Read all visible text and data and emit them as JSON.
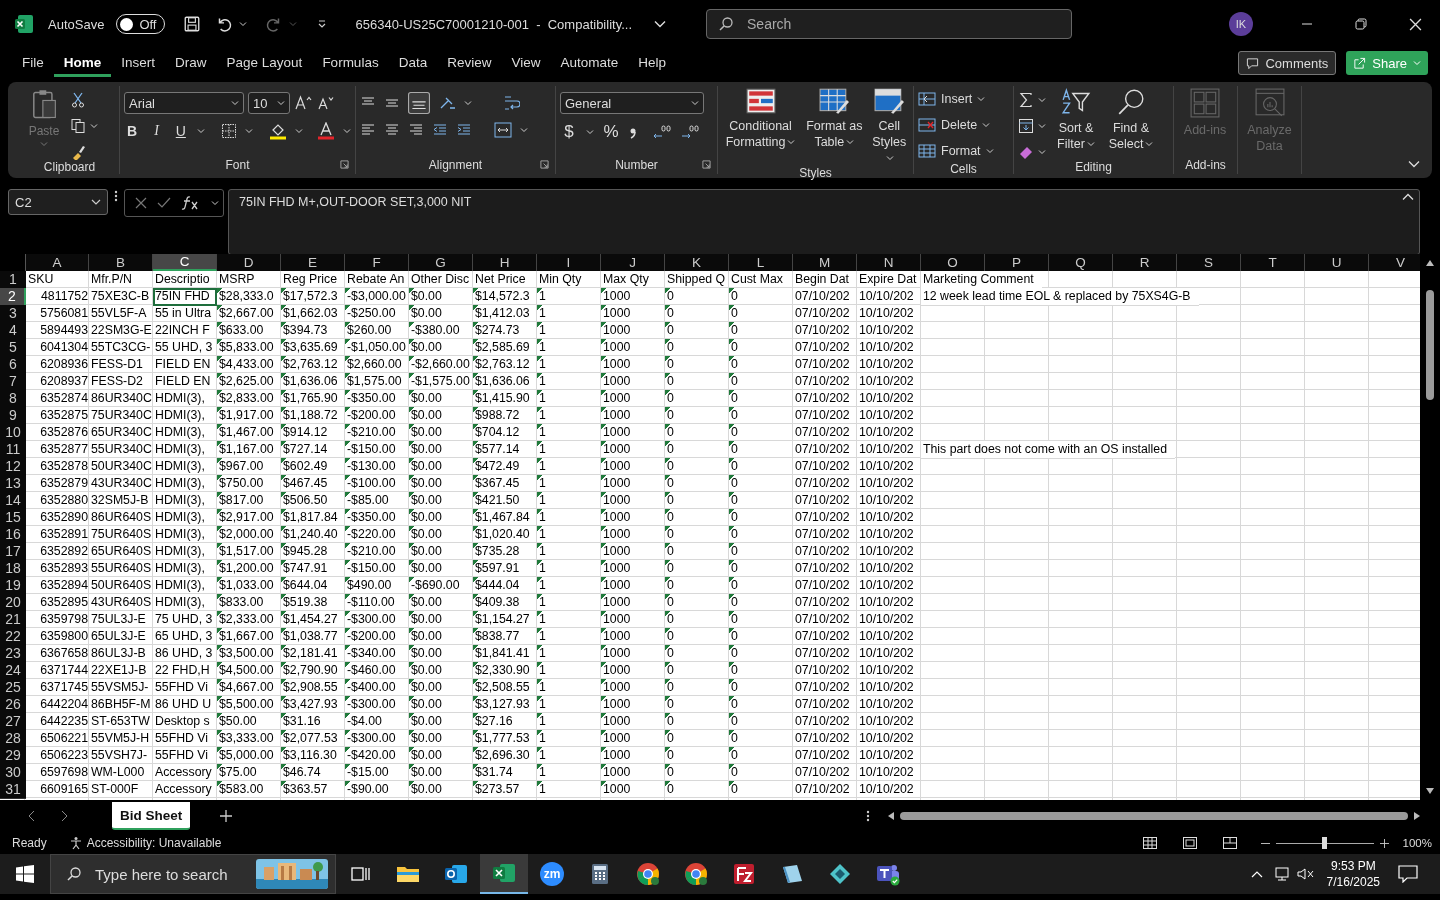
{
  "title_bar": {
    "autosave_label": "AutoSave",
    "autosave": {
      "on": false,
      "label": "Off"
    },
    "document_title": "656340-US25C70001210-001  -  Compatibility...",
    "search": {
      "placeholder": "Search"
    },
    "avatar": "IK"
  },
  "menu_tabs": [
    {
      "label": "File",
      "selected": false
    },
    {
      "label": "Home",
      "selected": true
    },
    {
      "label": "Insert",
      "selected": false
    },
    {
      "label": "Draw",
      "selected": false
    },
    {
      "label": "Page Layout",
      "selected": false
    },
    {
      "label": "Formulas",
      "selected": false
    },
    {
      "label": "Data",
      "selected": false
    },
    {
      "label": "Review",
      "selected": false
    },
    {
      "label": "View",
      "selected": false
    },
    {
      "label": "Automate",
      "selected": false
    },
    {
      "label": "Help",
      "selected": false
    }
  ],
  "header_buttons": [
    {
      "kind": "comments",
      "label": "Comments"
    },
    {
      "kind": "share",
      "label": "Share"
    }
  ],
  "ribbon": {
    "clipboard": {
      "label": "Clipboard",
      "paste": {
        "label": "Paste",
        "disabled": true
      }
    },
    "font": {
      "label": "Font",
      "family": "Arial",
      "size": "10",
      "bold": "B",
      "italic": "I",
      "underline": "U"
    },
    "alignment": {
      "label": "Alignment"
    },
    "number": {
      "label": "Number",
      "format": "General",
      "currency": "$",
      "percent": "%"
    },
    "styles": {
      "label": "Styles",
      "buttons": [
        {
          "kind": "conditional",
          "label": "Conditional Formatting"
        },
        {
          "kind": "table",
          "label": "Format as Table"
        },
        {
          "kind": "cellstyles",
          "label": "Cell Styles"
        }
      ]
    },
    "cells": {
      "label": "Cells",
      "buttons": [
        {
          "kind": "insert",
          "label": "Insert"
        },
        {
          "kind": "delete",
          "label": "Delete"
        },
        {
          "kind": "format",
          "label": "Format"
        }
      ]
    },
    "editing": {
      "label": "Editing",
      "buttons": [
        {
          "kind": "sort",
          "label": "Sort & Filter"
        },
        {
          "kind": "find",
          "label": "Find & Select"
        }
      ]
    },
    "addins": {
      "label": "Add-ins",
      "button": {
        "label": "Add-ins",
        "disabled": true
      }
    },
    "analyze": {
      "label": "Analyze Data",
      "disabled": true
    }
  },
  "formula_bar": {
    "name_box": "C2",
    "formula": "75IN FHD M+,OUT-DOOR SET,3,000 NIT"
  },
  "sheet": {
    "columns": [
      {
        "letter": "A",
        "kind": "numeric",
        "selected": false
      },
      {
        "letter": "B",
        "selected": false
      },
      {
        "letter": "C",
        "selected": true
      },
      {
        "letter": "D",
        "flagged": true,
        "selected": false
      },
      {
        "letter": "E",
        "flagged": true,
        "selected": false
      },
      {
        "letter": "F",
        "flagged": true,
        "selected": false
      },
      {
        "letter": "G",
        "flagged": true,
        "selected": false
      },
      {
        "letter": "H",
        "flagged": true,
        "selected": false
      },
      {
        "letter": "I",
        "flagged": true,
        "selected": false
      },
      {
        "letter": "J",
        "flagged": true,
        "selected": false
      },
      {
        "letter": "K",
        "flagged": true,
        "selected": false
      },
      {
        "letter": "L",
        "flagged": true,
        "selected": false
      },
      {
        "letter": "M",
        "selected": false
      },
      {
        "letter": "N",
        "selected": false
      },
      {
        "letter": "O",
        "selected": false
      },
      {
        "letter": "P",
        "selected": false
      },
      {
        "letter": "Q",
        "selected": false
      },
      {
        "letter": "R",
        "selected": false
      },
      {
        "letter": "S",
        "selected": false
      },
      {
        "letter": "T",
        "selected": false
      },
      {
        "letter": "U",
        "selected": false
      },
      {
        "letter": "V",
        "selected": false
      }
    ],
    "rows": [
      {
        "number": "1",
        "kind": "header",
        "selected": false,
        "cells": [
          "SKU",
          "Mfr.P/N",
          "Descriptio",
          "MSRP",
          "Reg Price",
          "Rebate An",
          "Other Disc",
          "Net Price",
          "Min Qty",
          "Max Qty",
          "Shipped Q",
          "Cust Max",
          "Begin Dat",
          "Expire Dat"
        ],
        "comment": "Marketing Comment"
      },
      {
        "number": "2",
        "kind": "data",
        "selected": true,
        "cells": [
          "4811752",
          "75XE3C-B",
          "75IN FHD",
          "$28,333.0",
          "$17,572.3",
          "-$3,000.00",
          "$0.00",
          "$14,572.3",
          "1",
          "1000",
          "0",
          "0",
          "07/10/202",
          "10/10/202"
        ],
        "comment": "12 week lead time EOL & replaced by 75XS4G-B"
      },
      {
        "number": "3",
        "kind": "data",
        "selected": false,
        "cells": [
          "5756081",
          "55VL5F-A",
          "55 in Ultra",
          "$2,667.00",
          "$1,662.03",
          "-$250.00",
          "$0.00",
          "$1,412.03",
          "1",
          "1000",
          "0",
          "0",
          "07/10/202",
          "10/10/202"
        ]
      },
      {
        "number": "4",
        "kind": "data",
        "selected": false,
        "cells": [
          "5894493",
          "22SM3G-E",
          "22INCH F",
          "$633.00",
          "$394.73",
          "$260.00",
          "-$380.00",
          "$274.73",
          "1",
          "1000",
          "0",
          "0",
          "07/10/202",
          "10/10/202"
        ]
      },
      {
        "number": "5",
        "kind": "data",
        "selected": false,
        "cells": [
          "6041304",
          "55TC3CG-",
          "55 UHD, 3",
          "$5,833.00",
          "$3,635.69",
          "-$1,050.00",
          "$0.00",
          "$2,585.69",
          "1",
          "1000",
          "0",
          "0",
          "07/10/202",
          "10/10/202"
        ]
      },
      {
        "number": "6",
        "kind": "data",
        "selected": false,
        "cells": [
          "6208936",
          "FESS-D1",
          "FIELD EN",
          "$4,433.00",
          "$2,763.12",
          "$2,660.00",
          "-$2,660.00",
          "$2,763.12",
          "1",
          "1000",
          "0",
          "0",
          "07/10/202",
          "10/10/202"
        ]
      },
      {
        "number": "7",
        "kind": "data",
        "selected": false,
        "cells": [
          "6208937",
          "FESS-D2",
          "FIELD EN",
          "$2,625.00",
          "$1,636.06",
          "$1,575.00",
          "-$1,575.00",
          "$1,636.06",
          "1",
          "1000",
          "0",
          "0",
          "07/10/202",
          "10/10/202"
        ]
      },
      {
        "number": "8",
        "kind": "data",
        "selected": false,
        "cells": [
          "6352874",
          "86UR340C",
          "HDMI(3),",
          "$2,833.00",
          "$1,765.90",
          "-$350.00",
          "$0.00",
          "$1,415.90",
          "1",
          "1000",
          "0",
          "0",
          "07/10/202",
          "10/10/202"
        ]
      },
      {
        "number": "9",
        "kind": "data",
        "selected": false,
        "cells": [
          "6352875",
          "75UR340C",
          "HDMI(3),",
          "$1,917.00",
          "$1,188.72",
          "-$200.00",
          "$0.00",
          "$988.72",
          "1",
          "1000",
          "0",
          "0",
          "07/10/202",
          "10/10/202"
        ]
      },
      {
        "number": "10",
        "kind": "data",
        "selected": false,
        "cells": [
          "6352876",
          "65UR340C",
          "HDMI(3),",
          "$1,467.00",
          "$914.12",
          "-$210.00",
          "$0.00",
          "$704.12",
          "1",
          "1000",
          "0",
          "0",
          "07/10/202",
          "10/10/202"
        ]
      },
      {
        "number": "11",
        "kind": "data",
        "selected": false,
        "cells": [
          "6352877",
          "55UR340C",
          "HDMI(3),",
          "$1,167.00",
          "$727.14",
          "-$150.00",
          "$0.00",
          "$577.14",
          "1",
          "1000",
          "0",
          "0",
          "07/10/202",
          "10/10/202"
        ],
        "comment": "This part does not come with an OS installed"
      },
      {
        "number": "12",
        "kind": "data",
        "selected": false,
        "cells": [
          "6352878",
          "50UR340C",
          "HDMI(3),",
          "$967.00",
          "$602.49",
          "-$130.00",
          "$0.00",
          "$472.49",
          "1",
          "1000",
          "0",
          "0",
          "07/10/202",
          "10/10/202"
        ]
      },
      {
        "number": "13",
        "kind": "data",
        "selected": false,
        "cells": [
          "6352879",
          "43UR340C",
          "HDMI(3),",
          "$750.00",
          "$467.45",
          "-$100.00",
          "$0.00",
          "$367.45",
          "1",
          "1000",
          "0",
          "0",
          "07/10/202",
          "10/10/202"
        ]
      },
      {
        "number": "14",
        "kind": "data",
        "selected": false,
        "cells": [
          "6352880",
          "32SM5J-B",
          "HDMI(3),",
          "$817.00",
          "$506.50",
          "-$85.00",
          "$0.00",
          "$421.50",
          "1",
          "1000",
          "0",
          "0",
          "07/10/202",
          "10/10/202"
        ]
      },
      {
        "number": "15",
        "kind": "data",
        "selected": false,
        "cells": [
          "6352890",
          "86UR640S",
          "HDMI(3),",
          "$2,917.00",
          "$1,817.84",
          "-$350.00",
          "$0.00",
          "$1,467.84",
          "1",
          "1000",
          "0",
          "0",
          "07/10/202",
          "10/10/202"
        ]
      },
      {
        "number": "16",
        "kind": "data",
        "selected": false,
        "cells": [
          "6352891",
          "75UR640S",
          "HDMI(3),",
          "$2,000.00",
          "$1,240.40",
          "-$220.00",
          "$0.00",
          "$1,020.40",
          "1",
          "1000",
          "0",
          "0",
          "07/10/202",
          "10/10/202"
        ]
      },
      {
        "number": "17",
        "kind": "data",
        "selected": false,
        "cells": [
          "6352892",
          "65UR640S",
          "HDMI(3),",
          "$1,517.00",
          "$945.28",
          "-$210.00",
          "$0.00",
          "$735.28",
          "1",
          "1000",
          "0",
          "0",
          "07/10/202",
          "10/10/202"
        ]
      },
      {
        "number": "18",
        "kind": "data",
        "selected": false,
        "cells": [
          "6352893",
          "55UR640S",
          "HDMI(3),",
          "$1,200.00",
          "$747.91",
          "-$150.00",
          "$0.00",
          "$597.91",
          "1",
          "1000",
          "0",
          "0",
          "07/10/202",
          "10/10/202"
        ]
      },
      {
        "number": "19",
        "kind": "data",
        "selected": false,
        "cells": [
          "6352894",
          "50UR640S",
          "HDMI(3),",
          "$1,033.00",
          "$644.04",
          "$490.00",
          "-$690.00",
          "$444.04",
          "1",
          "1000",
          "0",
          "0",
          "07/10/202",
          "10/10/202"
        ]
      },
      {
        "number": "20",
        "kind": "data",
        "selected": false,
        "cells": [
          "6352895",
          "43UR640S",
          "HDMI(3),",
          "$833.00",
          "$519.38",
          "-$110.00",
          "$0.00",
          "$409.38",
          "1",
          "1000",
          "0",
          "0",
          "07/10/202",
          "10/10/202"
        ]
      },
      {
        "number": "21",
        "kind": "data",
        "selected": false,
        "cells": [
          "6359798",
          "75UL3J-E",
          "75 UHD, 3",
          "$2,333.00",
          "$1,454.27",
          "-$300.00",
          "$0.00",
          "$1,154.27",
          "1",
          "1000",
          "0",
          "0",
          "07/10/202",
          "10/10/202"
        ]
      },
      {
        "number": "22",
        "kind": "data",
        "selected": false,
        "cells": [
          "6359800",
          "65UL3J-E",
          "65 UHD, 3",
          "$1,667.00",
          "$1,038.77",
          "-$200.00",
          "$0.00",
          "$838.77",
          "1",
          "1000",
          "0",
          "0",
          "07/10/202",
          "10/10/202"
        ]
      },
      {
        "number": "23",
        "kind": "data",
        "selected": false,
        "cells": [
          "6367658",
          "86UL3J-B",
          "86 UHD, 3",
          "$3,500.00",
          "$2,181.41",
          "-$340.00",
          "$0.00",
          "$1,841.41",
          "1",
          "1000",
          "0",
          "0",
          "07/10/202",
          "10/10/202"
        ]
      },
      {
        "number": "24",
        "kind": "data",
        "selected": false,
        "cells": [
          "6371744",
          "22XE1J-B",
          "22 FHD,H",
          "$4,500.00",
          "$2,790.90",
          "-$460.00",
          "$0.00",
          "$2,330.90",
          "1",
          "1000",
          "0",
          "0",
          "07/10/202",
          "10/10/202"
        ]
      },
      {
        "number": "25",
        "kind": "data",
        "selected": false,
        "cells": [
          "6371745",
          "55VSM5J-",
          "55FHD Vi",
          "$4,667.00",
          "$2,908.55",
          "-$400.00",
          "$0.00",
          "$2,508.55",
          "1",
          "1000",
          "0",
          "0",
          "07/10/202",
          "10/10/202"
        ]
      },
      {
        "number": "26",
        "kind": "data",
        "selected": false,
        "cells": [
          "6442204",
          "86BH5F-M",
          "86 UHD U",
          "$5,500.00",
          "$3,427.93",
          "-$300.00",
          "$0.00",
          "$3,127.93",
          "1",
          "1000",
          "0",
          "0",
          "07/10/202",
          "10/10/202"
        ]
      },
      {
        "number": "27",
        "kind": "data",
        "selected": false,
        "cells": [
          "6442235",
          "ST-653TW",
          "Desktop s",
          "$50.00",
          "$31.16",
          "-$4.00",
          "$0.00",
          "$27.16",
          "1",
          "1000",
          "0",
          "0",
          "07/10/202",
          "10/10/202"
        ]
      },
      {
        "number": "28",
        "kind": "data",
        "selected": false,
        "cells": [
          "6506221",
          "55VM5J-H",
          "55FHD Vi",
          "$3,333.00",
          "$2,077.53",
          "-$300.00",
          "$0.00",
          "$1,777.53",
          "1",
          "1000",
          "0",
          "0",
          "07/10/202",
          "10/10/202"
        ]
      },
      {
        "number": "29",
        "kind": "data",
        "selected": false,
        "cells": [
          "6506223",
          "55VSH7J-",
          "55FHD Vi",
          "$5,000.00",
          "$3,116.30",
          "-$420.00",
          "$0.00",
          "$2,696.30",
          "1",
          "1000",
          "0",
          "0",
          "07/10/202",
          "10/10/202"
        ]
      },
      {
        "number": "30",
        "kind": "data",
        "selected": false,
        "cells": [
          "6597698",
          "WM-L000",
          "Accessory",
          "$75.00",
          "$46.74",
          "-$15.00",
          "$0.00",
          "$31.74",
          "1",
          "1000",
          "0",
          "0",
          "07/10/202",
          "10/10/202"
        ]
      },
      {
        "number": "31",
        "kind": "data",
        "selected": false,
        "cells": [
          "6609165",
          "ST-000F",
          "Accessory",
          "$583.00",
          "$363.57",
          "-$90.00",
          "$0.00",
          "$273.57",
          "1",
          "1000",
          "0",
          "0",
          "07/10/202",
          "10/10/202"
        ]
      }
    ]
  },
  "sheet_tabs": [
    {
      "label": "Bid Sheet",
      "selected": true
    }
  ],
  "status_bar": {
    "mode": "Ready",
    "accessibility": "Accessibility: Unavailable",
    "zoom_slider": {
      "level": 0.5
    },
    "zoom": "100%"
  },
  "taskbar": {
    "search": {
      "placeholder": "Type here to search"
    },
    "apps": [
      {
        "kind": "taskview",
        "selected": false
      },
      {
        "kind": "folder",
        "selected": false
      },
      {
        "kind": "outlook",
        "selected": false
      },
      {
        "kind": "excel",
        "selected": true
      },
      {
        "kind": "zoom",
        "selected": false,
        "label": "zm"
      },
      {
        "kind": "calculator",
        "selected": false
      },
      {
        "kind": "chrome",
        "selected": false
      },
      {
        "kind": "chrome",
        "selected": false
      },
      {
        "kind": "filezilla",
        "selected": false
      },
      {
        "kind": "notepad",
        "selected": false
      },
      {
        "kind": "diamond",
        "selected": false
      },
      {
        "kind": "teams",
        "selected": false
      }
    ],
    "time": "9:53 PM",
    "date": "7/16/2025"
  }
}
